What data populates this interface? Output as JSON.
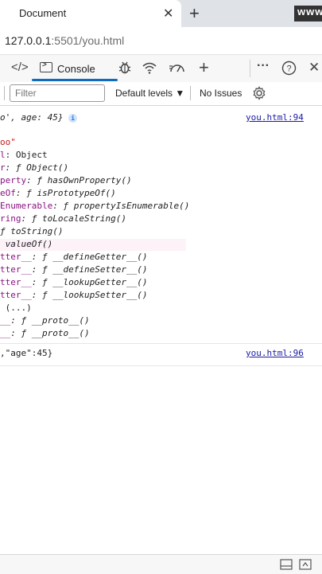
{
  "browser": {
    "tab_title": "Document",
    "tab_close": "✕",
    "new_tab": "+",
    "watermark": "www",
    "url_host": "127.0.0.1",
    "url_path": ":5501/you.html"
  },
  "devtools": {
    "tools": [
      {
        "icon": "elements-icon",
        "glyph": "</>"
      },
      {
        "icon": "console-icon",
        "label": "Console"
      },
      {
        "icon": "sources-bug-icon",
        "glyph": "🐞"
      },
      {
        "icon": "network-wifi-icon",
        "glyph": "📶"
      },
      {
        "icon": "performance-gauge-icon",
        "glyph": "◔"
      },
      {
        "icon": "more-tools-plus-icon",
        "glyph": "+"
      },
      {
        "icon": "more-options-icon",
        "glyph": "···"
      },
      {
        "icon": "help-icon",
        "glyph": "?"
      },
      {
        "icon": "close-devtools-icon",
        "glyph": "✕"
      }
    ],
    "console_label": "Console",
    "filter_placeholder": "Filter",
    "default_levels": "Default levels ▼",
    "no_issues": "No Issues"
  },
  "console": {
    "entry1": {
      "text": "o', age: 45}",
      "source": "you.html:94"
    },
    "object_lines": [
      {
        "k": "oo\"",
        "v": "",
        "kind": "str"
      },
      {
        "k": "l",
        "v": ": Object",
        "kind": "plain"
      },
      {
        "k": "r",
        "v": ": ƒ Object()",
        "kind": "fn"
      },
      {
        "k": "perty",
        "v": ": ƒ hasOwnProperty()",
        "kind": "fn"
      },
      {
        "k": "eOf",
        "v": ": ƒ isPrototypeOf()",
        "kind": "fn"
      },
      {
        "k": "Enumerable",
        "v": ": ƒ propertyIsEnumerable()",
        "kind": "fn"
      },
      {
        "k": "ring",
        "v": ": ƒ toLocaleString()",
        "kind": "fn"
      },
      {
        "k": "",
        "v": "ƒ toString()",
        "kind": "fn"
      },
      {
        "k": "",
        "v": " valueOf()",
        "kind": "fn"
      },
      {
        "k": "tter__",
        "v": ": ƒ __defineGetter__()",
        "kind": "fn"
      },
      {
        "k": "tter__",
        "v": ": ƒ __defineSetter__()",
        "kind": "fn"
      },
      {
        "k": "tter__",
        "v": ": ƒ __lookupGetter__()",
        "kind": "fn"
      },
      {
        "k": "tter__",
        "v": ": ƒ __lookupSetter__()",
        "kind": "fn"
      },
      {
        "k": "",
        "v": " (...)",
        "kind": "plain"
      },
      {
        "k": "__",
        "v": ": ƒ __proto__()",
        "kind": "fn"
      },
      {
        "k": "__",
        "v": ": ƒ __proto__()",
        "kind": "fn"
      }
    ],
    "entry2": {
      "text": ",\"age\":45}",
      "source": "you.html:96"
    }
  },
  "statusbar": {
    "icons": [
      "dock-icon",
      "screencast-icon"
    ]
  }
}
